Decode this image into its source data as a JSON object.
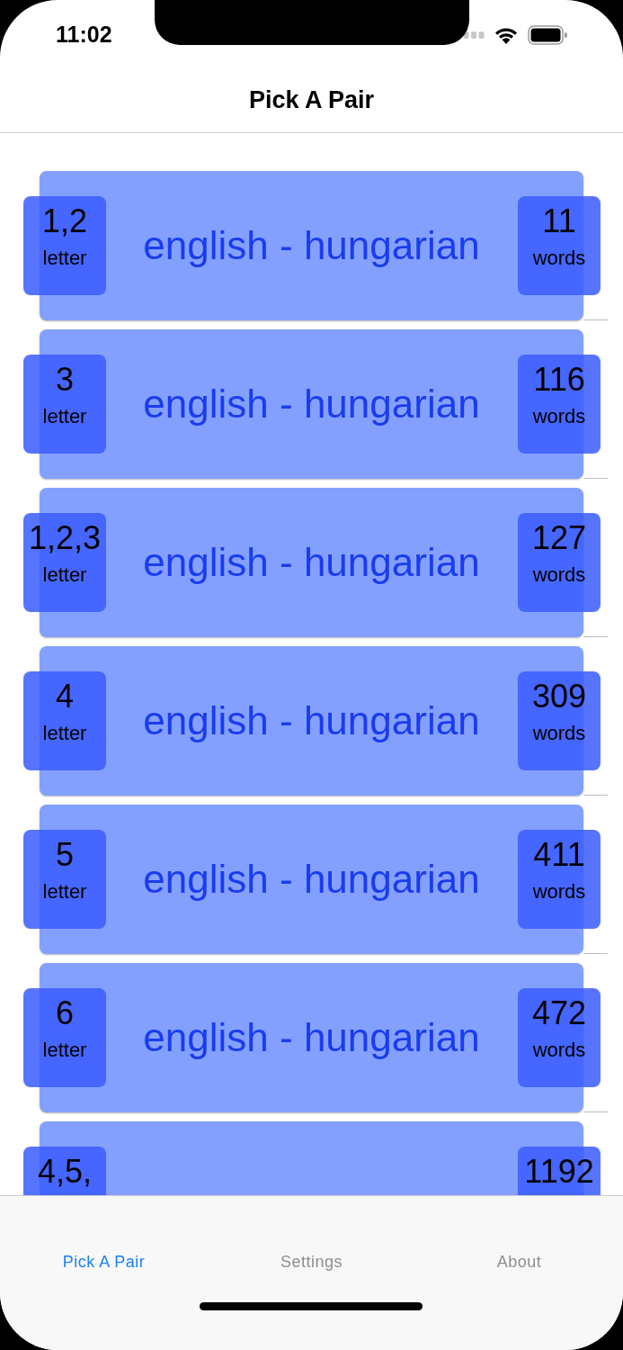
{
  "status_bar": {
    "time": "11:02"
  },
  "nav": {
    "title": "Pick A Pair"
  },
  "rows": [
    {
      "letters": "1,2",
      "letters_label": "letter",
      "title": "english - hungarian",
      "count": "11",
      "count_label": "words"
    },
    {
      "letters": "3",
      "letters_label": "letter",
      "title": "english - hungarian",
      "count": "116",
      "count_label": "words"
    },
    {
      "letters": "1,2,3",
      "letters_label": "letter",
      "title": "english - hungarian",
      "count": "127",
      "count_label": "words"
    },
    {
      "letters": "4",
      "letters_label": "letter",
      "title": "english - hungarian",
      "count": "309",
      "count_label": "words"
    },
    {
      "letters": "5",
      "letters_label": "letter",
      "title": "english - hungarian",
      "count": "411",
      "count_label": "words"
    },
    {
      "letters": "6",
      "letters_label": "letter",
      "title": "english - hungarian",
      "count": "472",
      "count_label": "words"
    },
    {
      "letters": "4,5,",
      "count": "1192"
    }
  ],
  "tabs": [
    {
      "label": "Pick A Pair",
      "selected": true
    },
    {
      "label": "Settings",
      "selected": false
    },
    {
      "label": "About",
      "selected": false
    }
  ]
}
